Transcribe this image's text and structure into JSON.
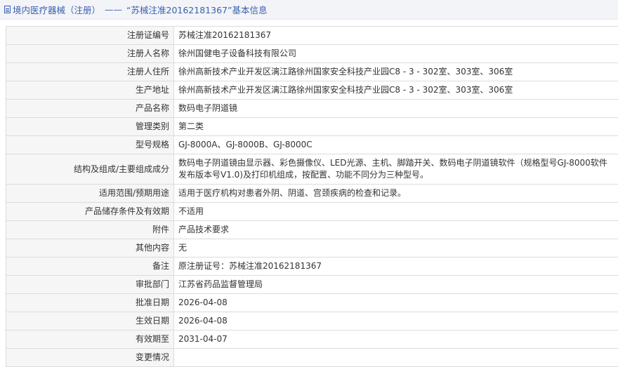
{
  "header": {
    "title_left": "境内医疗器械（注册）",
    "separator": "——",
    "title_right": "“苏械注准20162181367”基本信息"
  },
  "rows": [
    {
      "label": "注册证编号",
      "value": "苏械注准20162181367"
    },
    {
      "label": "注册人名称",
      "value": "徐州国健电子设备科技有限公司"
    },
    {
      "label": "注册人住所",
      "value": "徐州高新技术产业开发区漓江路徐州国家安全科技产业园C8 - 3 - 302室、303室、306室"
    },
    {
      "label": "生产地址",
      "value": "徐州高新技术产业开发区漓江路徐州国家安全科技产业园C8 - 3 - 302室、303室、306室"
    },
    {
      "label": "产品名称",
      "value": "数码电子阴道镜"
    },
    {
      "label": "管理类别",
      "value": "第二类"
    },
    {
      "label": "型号规格",
      "value": "GJ-8000A、GJ-8000B、GJ-8000C"
    },
    {
      "label": "结构及组成/主要组成成分",
      "value": "数码电子阴道镜由显示器、彩色摄像仪、LED光源、主机、脚踏开关、数码电子阴道镜软件（规格型号GJ-8000软件发布版本号V1.0)及打印机组成，按配置、功能不同分为三种型号。"
    },
    {
      "label": "适用范围/预期用途",
      "value": "适用于医疗机构对患者外阴、阴道、宫颈疾病的检查和记录。"
    },
    {
      "label": "产品储存条件及有效期",
      "value": "不适用"
    },
    {
      "label": "附件",
      "value": "产品技术要求"
    },
    {
      "label": "其他内容",
      "value": "无"
    },
    {
      "label": "备注",
      "value": "原注册证号：苏械注准20162181367"
    },
    {
      "label": "审批部门",
      "value": "江苏省药品监督管理局"
    },
    {
      "label": "批准日期",
      "value": "2026-04-08"
    },
    {
      "label": "生效日期",
      "value": "2026-04-08"
    },
    {
      "label": "有效期至",
      "value": "2031-04-07"
    },
    {
      "label": "变更情况",
      "value": ""
    }
  ]
}
